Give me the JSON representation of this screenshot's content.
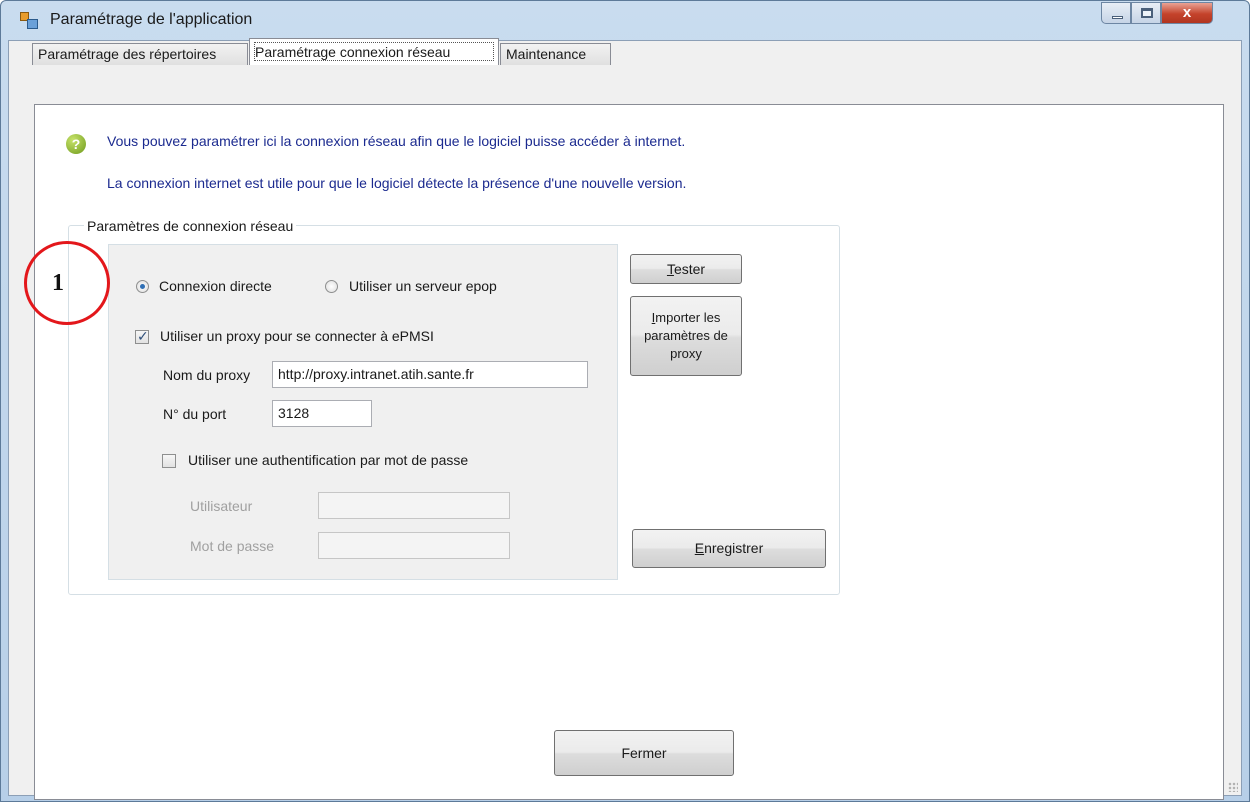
{
  "window": {
    "title": "Paramétrage de l'application",
    "close_glyph": "x"
  },
  "tabs": [
    {
      "label": "Paramétrage des répertoires"
    },
    {
      "label": "Paramétrage connexion réseau",
      "selected": true
    },
    {
      "label": "Maintenance"
    }
  ],
  "info": {
    "icon": "question-icon",
    "icon_glyph": "?",
    "line1": "Vous pouvez paramétrer ici la connexion réseau afin que le logiciel puisse accéder à internet.",
    "line2": "La connexion internet est utile pour que le logiciel détecte la présence d'une nouvelle version."
  },
  "group": {
    "title": "Paramètres de connexion réseau",
    "radio_direct": {
      "label": "Connexion directe",
      "checked": true
    },
    "radio_epop": {
      "label": "Utiliser un serveur epop",
      "checked": false
    },
    "proxy_checkbox": {
      "label": "Utiliser un proxy pour se connecter à ePMSI",
      "checked": true
    },
    "proxy_name": {
      "label": "Nom du proxy",
      "value": "http://proxy.intranet.atih.sante.fr"
    },
    "proxy_port": {
      "label": "N° du port",
      "value": "3128"
    },
    "auth_checkbox": {
      "label": "Utiliser une authentification par mot de passe",
      "checked": false
    },
    "user": {
      "label": "Utilisateur",
      "value": ""
    },
    "password": {
      "label": "Mot de passe",
      "value": ""
    }
  },
  "buttons": {
    "tester": {
      "mnemonic": "T",
      "rest": "ester"
    },
    "import_line1": {
      "mnemonic": "I",
      "rest": "mporter les"
    },
    "import_line2": "paramètres de",
    "import_line3": "proxy",
    "save": {
      "mnemonic": "E",
      "rest": "nregistrer"
    },
    "close": "Fermer"
  },
  "annotation": {
    "number": "1",
    "color": "#e3171b"
  },
  "colors": {
    "info_text": "#1b2a8f",
    "accent": "#2f6fb5"
  }
}
